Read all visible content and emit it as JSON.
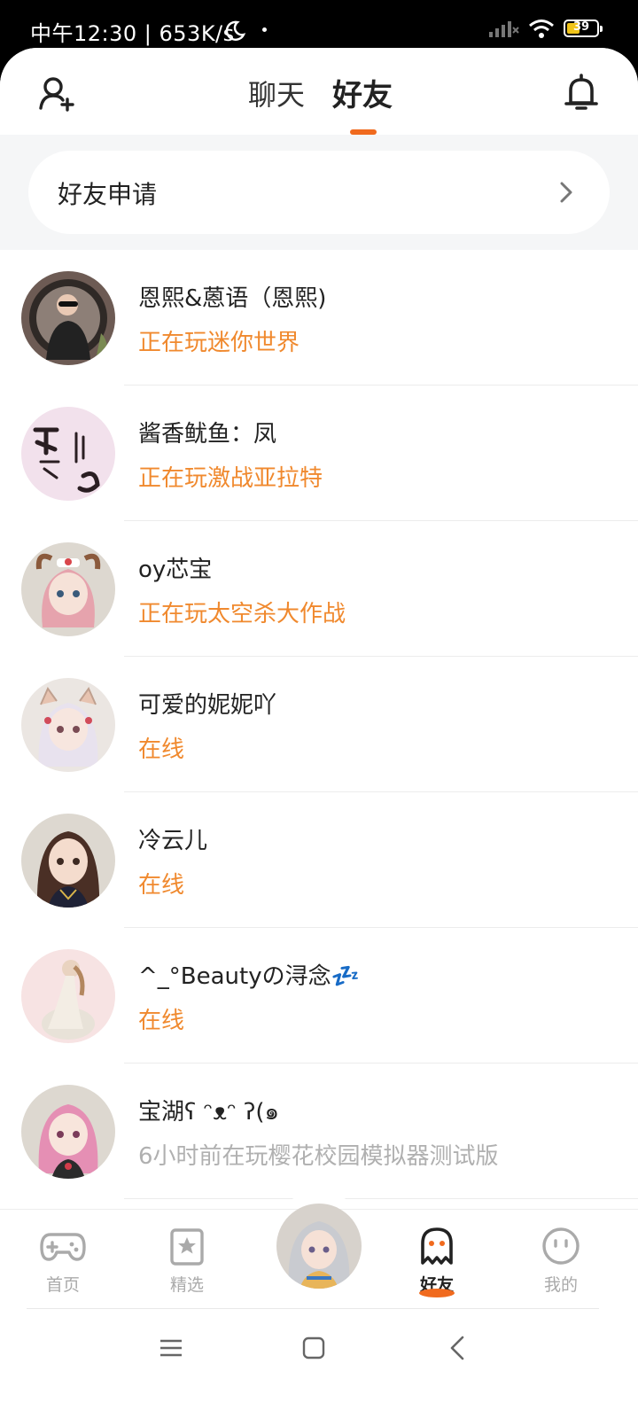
{
  "status_bar": {
    "time": "中午12:30 | 653K/s",
    "battery": "39"
  },
  "header": {
    "tabs": [
      "聊天",
      "好友"
    ],
    "active_tab": "好友"
  },
  "friend_request": {
    "label": "好友申请"
  },
  "friends": [
    {
      "name": "恩熙&蒽语（恩熙)",
      "status": "正在玩迷你世界",
      "status_type": "playing"
    },
    {
      "name": "酱香鱿鱼：凤",
      "status": "正在玩激战亚拉特",
      "status_type": "playing"
    },
    {
      "name": "oy芯宝",
      "status": "正在玩太空杀大作战",
      "status_type": "playing"
    },
    {
      "name": "可爱的妮妮吖",
      "status": "在线",
      "status_type": "online"
    },
    {
      "name": "冷云儿",
      "status": "在线",
      "status_type": "online"
    },
    {
      "name": "^_°Beautyの浔念💤",
      "status": "在线",
      "status_type": "online"
    },
    {
      "name": "宝湖ʕ ᵔᴥᵔ ʔ(๑",
      "status": "6小时前在玩樱花校园模拟器测试版",
      "status_type": "offline"
    }
  ],
  "bottom_nav": {
    "items": [
      {
        "label": "首页",
        "icon": "gamepad-icon"
      },
      {
        "label": "精选",
        "icon": "star-card-icon"
      },
      {
        "label": "好友",
        "icon": "ghost-icon",
        "active": true
      },
      {
        "label": "我的",
        "icon": "smiley-icon"
      }
    ]
  },
  "colors": {
    "accent": "#f06a1e",
    "status_orange": "#f0892e",
    "offline_grey": "#b0b0b0"
  }
}
